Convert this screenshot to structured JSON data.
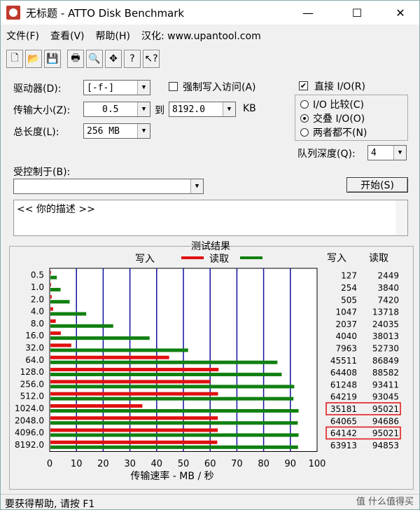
{
  "window": {
    "title": "无标题 - ATTO Disk Benchmark",
    "minimize": "—",
    "maximize": "☐",
    "close": "✕"
  },
  "menu": {
    "items": [
      "文件(F)",
      "查看(V)",
      "帮助(H)",
      "汉化: www.upantool.com"
    ]
  },
  "toolbar": {
    "icons": [
      "new-file-icon",
      "open-folder-icon",
      "save-icon",
      "print-icon",
      "print-preview-icon",
      "move-icon",
      "help-icon",
      "context-help-icon"
    ],
    "glyphs": [
      "🗋",
      "📂",
      "💾",
      "🖶",
      "🔍",
      "✥",
      "?",
      "↖?"
    ]
  },
  "drive": {
    "label": "驱动器(D):",
    "value": "[-f-]"
  },
  "transfer": {
    "label": "传输大小(Z):",
    "from": "0.5",
    "to_label": "到",
    "to": "8192.0",
    "unit": "KB"
  },
  "length": {
    "label": "总长度(L):",
    "value": "256 MB"
  },
  "force_write": {
    "label": "强制写入访问(A)",
    "checked": false
  },
  "direct_io": {
    "label": "直接 I/O(R)",
    "checked": true
  },
  "io_mode": {
    "options": [
      "I/O 比较(C)",
      "交叠 I/O(O)",
      "两者都不(N)"
    ],
    "selected": 1
  },
  "queue": {
    "label": "队列深度(Q):",
    "value": "4"
  },
  "controlled": {
    "label": "受控制于(B):",
    "value": ""
  },
  "start_button": "开始(S)",
  "description": {
    "text": "<<  你的描述   >>"
  },
  "colors": {
    "write": "#e01010",
    "read": "#108010",
    "grid": "#1010a0"
  },
  "chart_data": {
    "type": "bar",
    "title": "测试结果",
    "legend": [
      {
        "name": "写入",
        "color": "#e01010"
      },
      {
        "name": "读取",
        "color": "#108010"
      }
    ],
    "xlabel": "传输速率 - MB / 秒",
    "xlim": [
      0,
      100
    ],
    "xticks": [
      0,
      10,
      20,
      30,
      40,
      50,
      60,
      70,
      80,
      90,
      100
    ],
    "categories": [
      "0.5",
      "1.0",
      "2.0",
      "4.0",
      "8.0",
      "16.0",
      "32.0",
      "64.0",
      "128.0",
      "256.0",
      "512.0",
      "1024.0",
      "2048.0",
      "4096.0",
      "8192.0"
    ],
    "series": [
      {
        "name": "写入",
        "values": [
          0.1,
          0.2,
          0.5,
          1.0,
          2.0,
          3.9,
          7.8,
          44.4,
          62.9,
          59.8,
          62.7,
          34.4,
          62.6,
          62.6,
          62.4
        ]
      },
      {
        "name": "读取",
        "values": [
          2.4,
          3.8,
          7.2,
          13.4,
          23.5,
          37.1,
          51.5,
          84.9,
          86.5,
          91.2,
          90.9,
          92.8,
          92.5,
          92.8,
          92.6
        ]
      }
    ],
    "table_headers": [
      "写入",
      "读取"
    ],
    "write_values": [
      "127",
      "254",
      "505",
      "1047",
      "2037",
      "4040",
      "7963",
      "45511",
      "64408",
      "61248",
      "64219",
      "35181",
      "64065",
      "64142",
      "63913"
    ],
    "read_values": [
      "2449",
      "3840",
      "7420",
      "13718",
      "24035",
      "38013",
      "52730",
      "86849",
      "88582",
      "93411",
      "93045",
      "95021",
      "94686",
      "95021",
      "94853"
    ],
    "highlighted_rows": [
      11,
      13
    ]
  },
  "status": {
    "text": "要获得帮助, 请按 F1"
  },
  "watermark": "值 什么值得买"
}
